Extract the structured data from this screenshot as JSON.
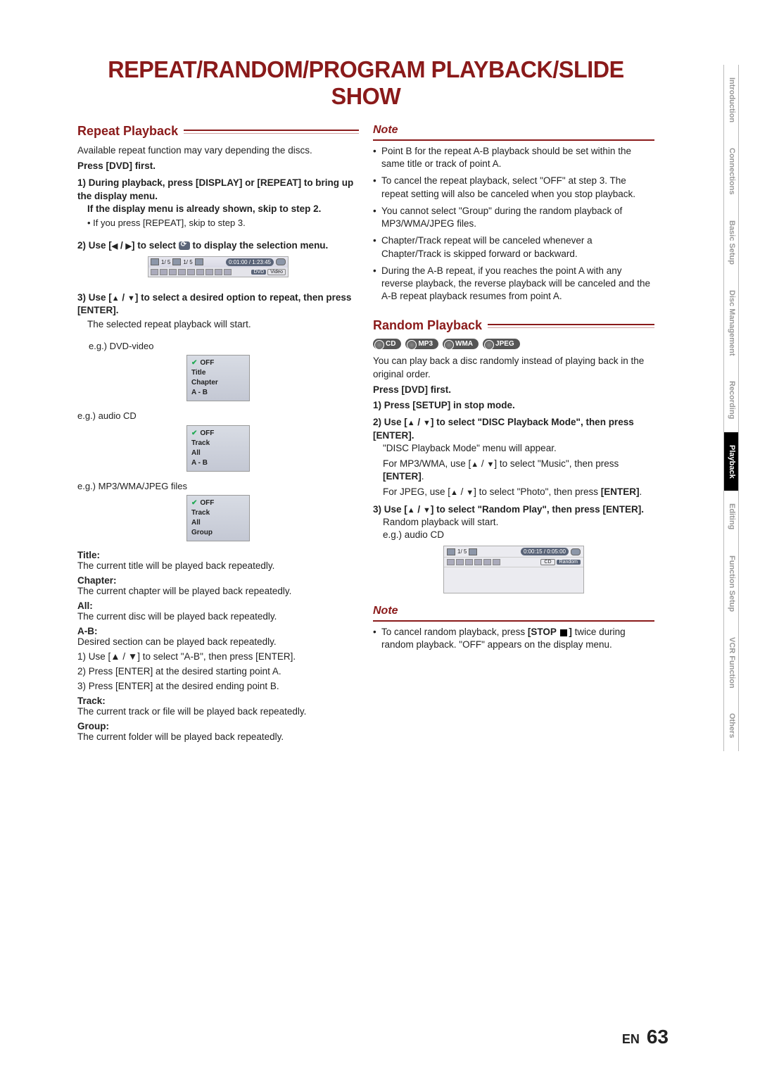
{
  "title": "REPEAT/RANDOM/PROGRAM PLAYBACK/SLIDE SHOW",
  "repeat": {
    "heading": "Repeat Playback",
    "intro": "Available repeat function may vary depending the discs.",
    "press_dvd": "Press [DVD] first.",
    "step1a": "1) During playback, press [DISPLAY] or [REPEAT] to bring up the display menu.",
    "step1b": "If the display menu is already shown, skip to step 2.",
    "step1c": "• If you press [REPEAT], skip to step 3.",
    "step2a": "2) Use [",
    "step2b": "] to select ",
    "step2c": " to display the selection menu.",
    "display_bar": {
      "seg1": "1/   5",
      "seg2": "1/   5",
      "time": "0:01:00 / 1:23:45",
      "tag1": "DVD",
      "tag2": "Video"
    },
    "step3a": "3) Use [",
    "step3b": "] to select a desired option to repeat, then press [ENTER].",
    "step3c": "The selected repeat playback will start.",
    "eg_dvd": "e.g.) DVD-video",
    "menu_dvd": [
      "OFF",
      "Title",
      "Chapter",
      "A - B"
    ],
    "eg_cd": "e.g.) audio CD",
    "menu_cd": [
      "OFF",
      "Track",
      "All",
      "A - B"
    ],
    "eg_mp3": "e.g.) MP3/WMA/JPEG files",
    "menu_mp3": [
      "OFF",
      "Track",
      "All",
      "Group"
    ],
    "defs": {
      "title_h": "Title:",
      "title_t": "The current title will be played back repeatedly.",
      "chapter_h": "Chapter:",
      "chapter_t": "The current chapter will be played back repeatedly.",
      "all_h": "All:",
      "all_t": "The current disc will be played back repeatedly.",
      "ab_h": "A-B:",
      "ab_t": "Desired section can be played back repeatedly.",
      "ab_s1": "1) Use [▲ / ▼] to select \"A-B\", then press [ENTER].",
      "ab_s2": "2) Press [ENTER] at the desired starting point A.",
      "ab_s3": "3) Press [ENTER] at the desired ending point B.",
      "track_h": "Track:",
      "track_t": "The current track or file will be played back repeatedly.",
      "group_h": "Group:",
      "group_t": "The current folder will be played back repeatedly."
    }
  },
  "note1": {
    "heading": "Note",
    "items": [
      "Point B for the repeat A-B playback should be set within the same title or track of point A.",
      "To cancel the repeat playback, select \"OFF\" at step 3. The repeat setting will also be canceled when you stop playback.",
      "You cannot select \"Group\" during the random playback of MP3/WMA/JPEG files.",
      "Chapter/Track repeat will be canceled whenever a Chapter/Track is skipped forward or backward.",
      "During the A-B repeat, if you reaches the point A with any reverse playback, the reverse playback will be canceled and the A-B repeat playback resumes from point A."
    ]
  },
  "random": {
    "heading": "Random Playback",
    "badges": [
      "CD",
      "MP3",
      "WMA",
      "JPEG"
    ],
    "intro": "You can play back a disc randomly instead of playing back in the original order.",
    "press_dvd": "Press [DVD] first.",
    "step1": "1) Press [SETUP] in stop mode.",
    "step2a": "2) Use [",
    "step2b": "] to select \"DISC Playback Mode\", then press [ENTER].",
    "step2c": "\"DISC Playback Mode\" menu will appear.",
    "step2d_a": "For MP3/WMA, use [",
    "step2d_b": "] to select \"Music\", then press ",
    "step2d_c": "[ENTER]",
    "step2e_a": "For JPEG, use [",
    "step2e_b": "] to select \"Photo\", then press ",
    "step2e_c": "[ENTER]",
    "step3a": "3) Use [",
    "step3b": "] to select \"Random Play\", then press [ENTER].",
    "step3c": "Random playback will start.",
    "eg": "e.g.) audio CD",
    "display": {
      "seg": "1/   5",
      "time": "0:00:15 / 0:05:00",
      "tag1": "CD",
      "tag2": "Random"
    }
  },
  "note2": {
    "heading": "Note",
    "item_a": "To cancel random playback, press ",
    "item_b": "[STOP ",
    "item_c": "]",
    "item_d": " twice during random playback. \"OFF\" appears on the display menu."
  },
  "sidebar": [
    "Introduction",
    "Connections",
    "Basic Setup",
    "Disc Management",
    "Recording",
    "Playback",
    "Editing",
    "Function Setup",
    "VCR Function",
    "Others"
  ],
  "sidebar_active": 5,
  "footer": {
    "lang": "EN",
    "page": "63"
  }
}
